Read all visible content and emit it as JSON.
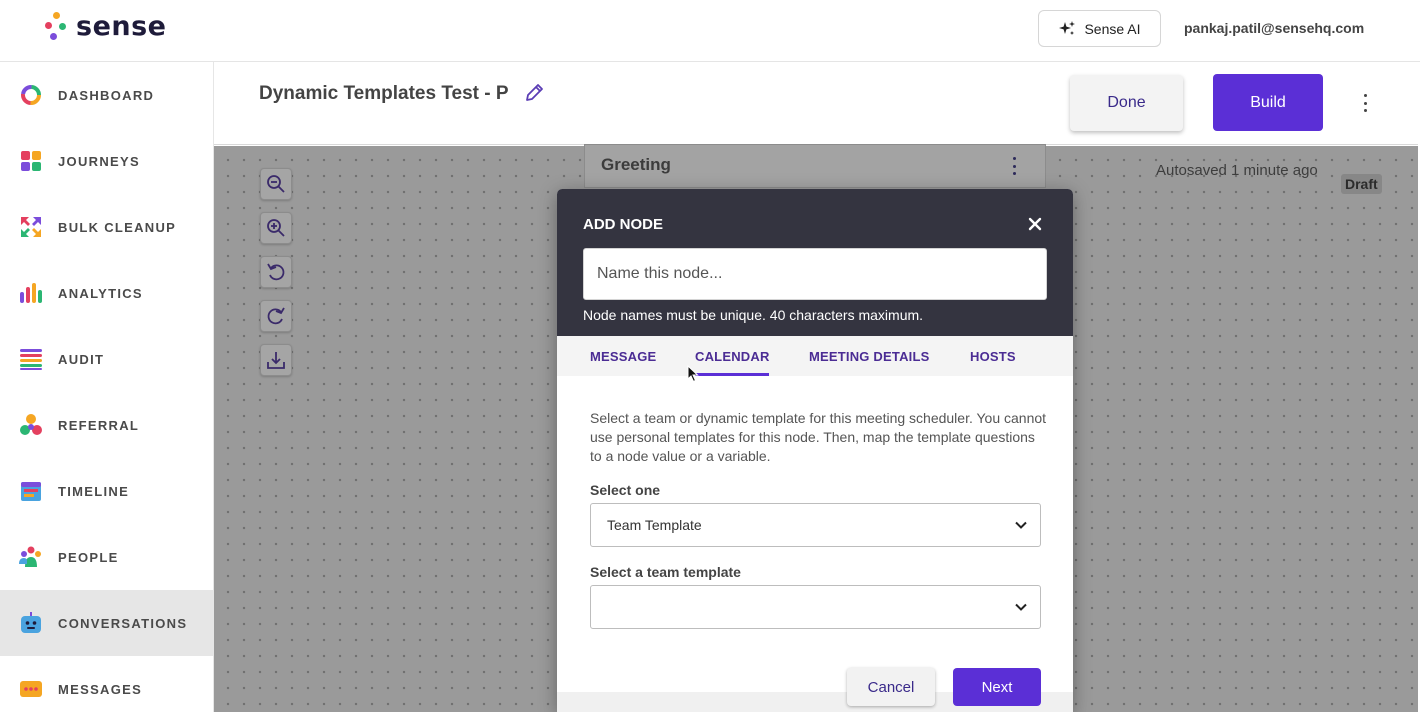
{
  "app": {
    "logo_text": "sense",
    "ai_button_label": "Sense AI",
    "user_email": "pankaj.patil@sensehq.com"
  },
  "sidebar": {
    "items": [
      {
        "label": "DASHBOARD",
        "icon": "dashboard-ring-icon"
      },
      {
        "label": "JOURNEYS",
        "icon": "journeys-grid-icon"
      },
      {
        "label": "BULK CLEANUP",
        "icon": "bulk-cleanup-arrows-icon"
      },
      {
        "label": "ANALYTICS",
        "icon": "analytics-bars-icon"
      },
      {
        "label": "AUDIT",
        "icon": "audit-list-icon"
      },
      {
        "label": "REFERRAL",
        "icon": "referral-circles-icon"
      },
      {
        "label": "TIMELINE",
        "icon": "timeline-calendar-icon"
      },
      {
        "label": "PEOPLE",
        "icon": "people-group-icon"
      },
      {
        "label": "CONVERSATIONS",
        "icon": "conversations-bot-icon",
        "active": true
      },
      {
        "label": "MESSAGES",
        "icon": "messages-bubble-icon"
      }
    ]
  },
  "header": {
    "title": "Dynamic Templates Test - P",
    "done_label": "Done",
    "build_label": "Build"
  },
  "canvas": {
    "greeting_title": "Greeting",
    "autosave_text": "Autosaved 1 minute ago",
    "draft_badge": "Draft",
    "tools": [
      "zoom-out-icon",
      "zoom-in-icon",
      "undo-icon",
      "redo-icon",
      "download-icon"
    ]
  },
  "modal": {
    "title": "ADD NODE",
    "name_placeholder": "Name this node...",
    "name_value": "",
    "hint": "Node names must be unique. 40 characters maximum.",
    "tabs": [
      {
        "label": "MESSAGE"
      },
      {
        "label": "CALENDAR",
        "active": true
      },
      {
        "label": "MEETING DETAILS"
      },
      {
        "label": "HOSTS"
      }
    ],
    "description": "Select a team or dynamic template for this meeting scheduler. You cannot use personal templates for this node. Then, map the template questions to a node value or a variable.",
    "select_one_label": "Select one",
    "select_one_value": "Team Template",
    "team_template_label": "Select a team template",
    "team_template_value": "",
    "cancel_label": "Cancel",
    "next_label": "Next"
  },
  "colors": {
    "accent": "#5b2fd6",
    "modal_header": "#343440",
    "tab_text": "#4b2c94"
  }
}
